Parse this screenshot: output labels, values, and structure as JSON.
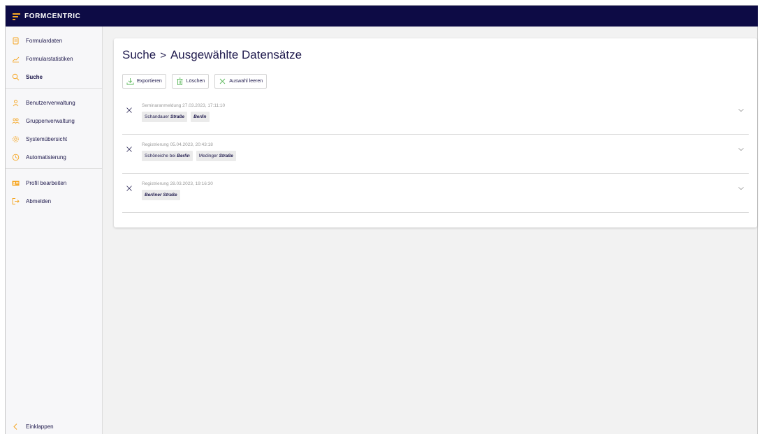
{
  "app": {
    "brand": "FORMCENTRIC",
    "accent_color": "#f5a623",
    "topbar_color": "#0d0b45"
  },
  "sidebar": {
    "groups": [
      [
        {
          "label": "Formulardaten",
          "icon": "document-icon",
          "active": false
        },
        {
          "label": "Formularstatistiken",
          "icon": "chart-line-icon",
          "active": false
        },
        {
          "label": "Suche",
          "icon": "search-icon",
          "active": true
        }
      ],
      [
        {
          "label": "Benutzerverwaltung",
          "icon": "user-icon",
          "active": false
        },
        {
          "label": "Gruppenverwaltung",
          "icon": "group-icon",
          "active": false
        },
        {
          "label": "Systemübersicht",
          "icon": "gear-icon",
          "active": false
        },
        {
          "label": "Automatisierung",
          "icon": "clock-icon",
          "active": false
        }
      ],
      [
        {
          "label": "Profil bearbeiten",
          "icon": "id-card-icon",
          "active": false
        },
        {
          "label": "Abmelden",
          "icon": "logout-icon",
          "active": false
        }
      ]
    ],
    "collapse_label": "Einklappen"
  },
  "main": {
    "breadcrumb": {
      "parent": "Suche",
      "separator": ">",
      "current": "Ausgewählte Datensätze"
    },
    "toolbar": {
      "export_label": "Exportieren",
      "delete_label": "Löschen",
      "clear_label": "Auswahl leeren"
    },
    "records": [
      {
        "title": "Seminaranmeldung 27.03.2023, 17:11:10",
        "tags": [
          {
            "plain": "Schandauer ",
            "bold": "Straße"
          },
          {
            "plain": "",
            "bold": "Berlin"
          }
        ]
      },
      {
        "title": "Registrierung 05.04.2023, 20:43:18",
        "tags": [
          {
            "plain": "Schöneiche bei ",
            "bold": "Berlin"
          },
          {
            "plain": "Medinger ",
            "bold": "Straße"
          }
        ]
      },
      {
        "title": "Registrierung 28.03.2023, 19:16:30",
        "tags": [
          {
            "plain": "",
            "bold": "Berliner Straße"
          }
        ]
      }
    ]
  }
}
